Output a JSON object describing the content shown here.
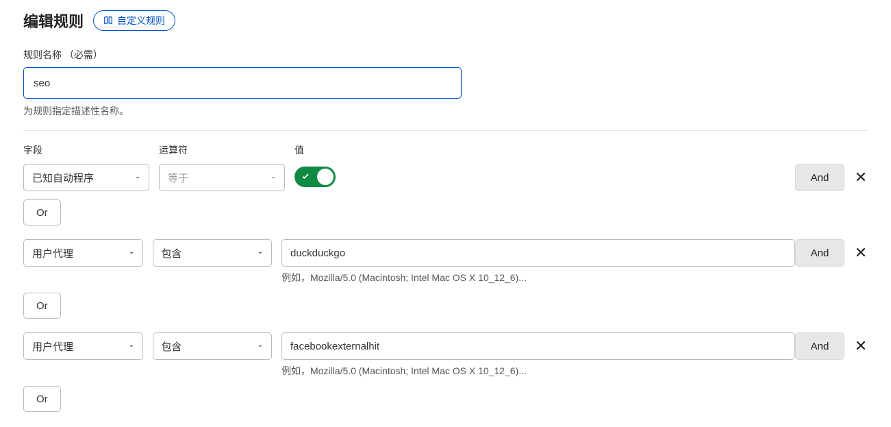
{
  "header": {
    "title": "编辑规则",
    "custom_rule_label": "自定义规则"
  },
  "name_field": {
    "label": "规则名称 （必需）",
    "value": "seo",
    "hint": "为规则指定描述性名称。"
  },
  "columns": {
    "field": "字段",
    "operator": "运算符",
    "value": "值"
  },
  "buttons": {
    "and": "And",
    "or": "Or"
  },
  "rows": [
    {
      "field": "已知自动程序",
      "operator": "等于",
      "operator_placeholder": true,
      "value_type": "toggle",
      "toggle_on": true
    },
    {
      "field": "用户代理",
      "operator": "包含",
      "operator_placeholder": false,
      "value_type": "text",
      "value": "duckduckgo",
      "hint": "例如，Mozilla/5.0 (Macintosh; Intel Mac OS X 10_12_6)..."
    },
    {
      "field": "用户代理",
      "operator": "包含",
      "operator_placeholder": false,
      "value_type": "text",
      "value": "facebookexternalhit",
      "hint": "例如，Mozilla/5.0 (Macintosh; Intel Mac OS X 10_12_6)..."
    }
  ]
}
